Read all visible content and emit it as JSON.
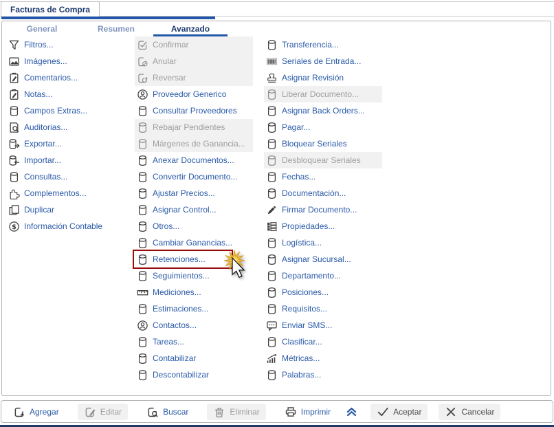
{
  "window": {
    "title_tab": "Facturas de Compra"
  },
  "tabs": [
    {
      "name": "tab-general",
      "label": "General"
    },
    {
      "name": "tab-resumen",
      "label": "Resumen"
    },
    {
      "name": "tab-avanzado",
      "label": "Avanzado",
      "active": true
    }
  ],
  "menu": {
    "left_column": [
      {
        "name": "menu-item-filtros",
        "label": "Filtros...",
        "icon": "funnel-icon"
      },
      {
        "name": "menu-item-imagenes",
        "label": "Imágenes...",
        "icon": "image-icon"
      },
      {
        "name": "menu-item-comentarios",
        "label": "Comentarios...",
        "icon": "clipboard-pencil-icon"
      },
      {
        "name": "menu-item-notas",
        "label": "Notas...",
        "icon": "clipboard-pencil-icon"
      },
      {
        "name": "menu-item-campos-extras",
        "label": "Campos Extras...",
        "icon": "cylinder-icon"
      },
      {
        "name": "menu-item-auditorias",
        "label": "Auditorias...",
        "icon": "document-search-icon"
      },
      {
        "name": "menu-item-exportar",
        "label": "Exportar...",
        "icon": "cylinder-export-icon"
      },
      {
        "name": "menu-item-importar",
        "label": "Importar...",
        "icon": "cylinder-import-icon"
      },
      {
        "name": "menu-item-consultas",
        "label": "Consultas...",
        "icon": "cylinder-icon"
      },
      {
        "name": "menu-item-complementos",
        "label": "Complementos...",
        "icon": "puzzle-icon"
      },
      {
        "name": "menu-item-duplicar",
        "label": "Duplicar",
        "icon": "copy-icon"
      },
      {
        "name": "menu-item-informacion-contable",
        "label": "Información Contable",
        "icon": "dollar-circle-icon"
      }
    ],
    "middle_column": [
      {
        "name": "menu-item-confirmar",
        "label": "Confirmar",
        "icon": "square-check-icon",
        "disabled": true
      },
      {
        "name": "menu-item-anular",
        "label": "Anular",
        "icon": "square-cancel-icon",
        "disabled": true
      },
      {
        "name": "menu-item-reversar",
        "label": "Reversar",
        "icon": "square-refresh-icon",
        "disabled": true
      },
      {
        "name": "menu-item-proveedor-generico",
        "label": "Proveedor Generico",
        "icon": "person-circle-icon"
      },
      {
        "name": "menu-item-consultar-proveedores",
        "label": "Consultar Proveedores",
        "icon": "cylinder-icon"
      },
      {
        "name": "menu-item-rebajar-pendientes",
        "label": "Rebajar Pendientes",
        "icon": "cylinder-icon",
        "disabled": true
      },
      {
        "name": "menu-item-margenes-de-ganancia",
        "label": "Márgenes de Ganancia...",
        "icon": "cylinder-icon",
        "disabled": true
      },
      {
        "name": "menu-item-anexar-documentos",
        "label": "Anexar Documentos...",
        "icon": "cylinder-icon"
      },
      {
        "name": "menu-item-convertir-documento",
        "label": "Convertir Documento...",
        "icon": "cylinder-icon"
      },
      {
        "name": "menu-item-ajustar-precios",
        "label": "Ajustar Precios...",
        "icon": "cylinder-icon"
      },
      {
        "name": "menu-item-asignar-control",
        "label": "Asignar Control...",
        "icon": "cylinder-icon"
      },
      {
        "name": "menu-item-otros",
        "label": "Otros...",
        "icon": "cylinder-icon"
      },
      {
        "name": "menu-item-cambiar-ganancias",
        "label": "Cambiar Ganancias...",
        "icon": "cylinder-icon"
      },
      {
        "name": "menu-item-retenciones",
        "label": "Retenciones...",
        "icon": "cylinder-icon",
        "highlight": true
      },
      {
        "name": "menu-item-seguimientos",
        "label": "Seguimientos...",
        "icon": "cylinder-icon"
      },
      {
        "name": "menu-item-mediciones",
        "label": "Mediciones...",
        "icon": "ruler-icon"
      },
      {
        "name": "menu-item-estimaciones",
        "label": "Estimaciones...",
        "icon": "cylinder-icon"
      },
      {
        "name": "menu-item-contactos",
        "label": "Contactos...",
        "icon": "person-circle-icon"
      },
      {
        "name": "menu-item-tareas",
        "label": "Tareas...",
        "icon": "cylinder-icon"
      },
      {
        "name": "menu-item-contabilizar",
        "label": "Contabilizar",
        "icon": "cylinder-icon"
      },
      {
        "name": "menu-item-descontabilizar",
        "label": "Descontabilizar",
        "icon": "cylinder-icon"
      }
    ],
    "right_column": [
      {
        "name": "menu-item-transferencia",
        "label": "Transferencia...",
        "icon": "cylinder-icon"
      },
      {
        "name": "menu-item-seriales-de-entrada",
        "label": "Seriales de Entrada...",
        "icon": "barcode-icon"
      },
      {
        "name": "menu-item-asignar-revision",
        "label": "Asignar Revisión",
        "icon": "stamp-icon"
      },
      {
        "name": "menu-item-liberar-documento",
        "label": "Liberar Documento...",
        "icon": "cylinder-icon",
        "disabled": true
      },
      {
        "name": "menu-item-asignar-back-orders",
        "label": "Asignar Back Orders...",
        "icon": "cylinder-icon"
      },
      {
        "name": "menu-item-pagar",
        "label": "Pagar...",
        "icon": "cylinder-icon"
      },
      {
        "name": "menu-item-bloquear-seriales",
        "label": "Bloquear Seriales",
        "icon": "cylinder-icon"
      },
      {
        "name": "menu-item-desbloquear-seriales",
        "label": "Desbloquear Seriales",
        "icon": "cylinder-icon",
        "disabled": true
      },
      {
        "name": "menu-item-fechas",
        "label": "Fechas...",
        "icon": "cylinder-icon"
      },
      {
        "name": "menu-item-documentacion",
        "label": "Documentación...",
        "icon": "cylinder-icon"
      },
      {
        "name": "menu-item-firmar-documento",
        "label": "Firmar Documento...",
        "icon": "pen-icon"
      },
      {
        "name": "menu-item-propiedades",
        "label": "Propiedades...",
        "icon": "grid-icon"
      },
      {
        "name": "menu-item-logistica",
        "label": "Logística...",
        "icon": "cylinder-icon"
      },
      {
        "name": "menu-item-asignar-sucursal",
        "label": "Asignar Sucursal...",
        "icon": "cylinder-icon"
      },
      {
        "name": "menu-item-departamento",
        "label": "Departamento...",
        "icon": "cylinder-icon"
      },
      {
        "name": "menu-item-posiciones",
        "label": "Posiciones...",
        "icon": "cylinder-icon"
      },
      {
        "name": "menu-item-requisitos",
        "label": "Requisitos...",
        "icon": "cylinder-icon"
      },
      {
        "name": "menu-item-enviar-sms",
        "label": "Enviar SMS...",
        "icon": "sms-icon"
      },
      {
        "name": "menu-item-clasificar",
        "label": "Clasificar...",
        "icon": "cylinder-icon"
      },
      {
        "name": "menu-item-metricas",
        "label": "Métricas...",
        "icon": "chart-up-icon"
      },
      {
        "name": "menu-item-palabras",
        "label": "Palabras...",
        "icon": "cylinder-icon"
      }
    ]
  },
  "cursor": {
    "over_item": "Retenciones...",
    "style": "arrow-with-click-starburst"
  },
  "toolbar": {
    "left_buttons": [
      {
        "name": "agregar-button",
        "label": "Agregar",
        "icon": "add-square-icon"
      },
      {
        "name": "editar-button",
        "label": "Editar",
        "icon": "edit-square-icon",
        "disabled": true
      },
      {
        "name": "buscar-button",
        "label": "Buscar",
        "icon": "search-square-icon"
      },
      {
        "name": "eliminar-button",
        "label": "Eliminar",
        "icon": "trash-icon",
        "disabled": true
      },
      {
        "name": "imprimir-button",
        "label": "Imprimir",
        "icon": "printer-icon"
      }
    ],
    "collapse_icon": "chevron-double-up-icon",
    "right_buttons": [
      {
        "name": "aceptar-button",
        "label": "Aceptar",
        "icon": "check-icon",
        "neutral": true
      },
      {
        "name": "cancelar-button",
        "label": "Cancelar",
        "icon": "x-icon",
        "neutral": true
      }
    ]
  },
  "colors": {
    "accent_blue": "#2257a8",
    "link_blue": "#2a5aa8",
    "navy": "#1c3a6e",
    "muted_tab": "#8195bd",
    "disabled_text": "#9e9e9e",
    "disabled_bg": "#f1f1f1",
    "icon_gray": "#3f3f3f",
    "highlight_red": "#9b0b0b",
    "star_gold": "#f5c33b",
    "bottom_bar": "#1f3a68"
  }
}
